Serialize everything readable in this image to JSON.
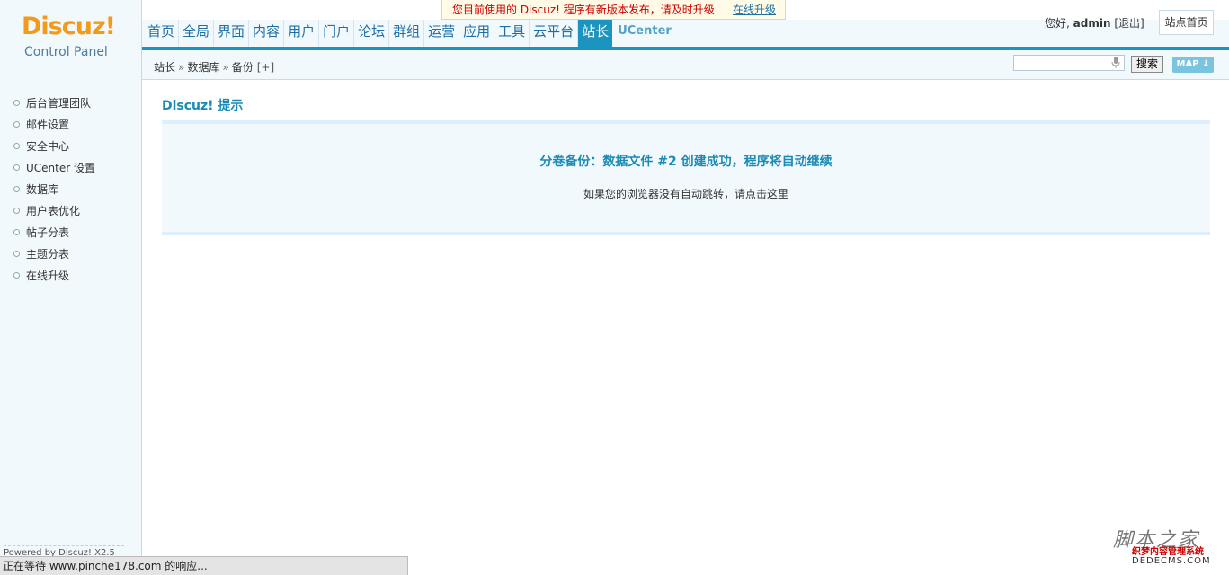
{
  "header": {
    "logo": "Discuz!",
    "logo_sub": "Control Panel",
    "notice_text": "您目前使用的 Discuz! 程序有新版本发布，请及时升级",
    "notice_link": "在线升级",
    "greeting_prefix": "您好, ",
    "username": "admin",
    "logout": "[退出]",
    "site_home": "站点首页",
    "search_button": "搜索",
    "map_button": "MAP"
  },
  "nav": {
    "items": [
      {
        "label": "首页"
      },
      {
        "label": "全局"
      },
      {
        "label": "界面"
      },
      {
        "label": "内容"
      },
      {
        "label": "用户"
      },
      {
        "label": "门户"
      },
      {
        "label": "论坛"
      },
      {
        "label": "群组"
      },
      {
        "label": "运营"
      },
      {
        "label": "应用"
      },
      {
        "label": "工具"
      },
      {
        "label": "云平台"
      },
      {
        "label": "站长"
      },
      {
        "label": "UCenter"
      }
    ],
    "active": "站长"
  },
  "breadcrumb": {
    "items": [
      "站长",
      "数据库",
      "备份"
    ],
    "separator": "»",
    "add": "[+]"
  },
  "sidebar": {
    "items": [
      {
        "label": "后台管理团队"
      },
      {
        "label": "邮件设置"
      },
      {
        "label": "安全中心"
      },
      {
        "label": "UCenter 设置"
      },
      {
        "label": "数据库"
      },
      {
        "label": "用户表优化"
      },
      {
        "label": "帖子分表"
      },
      {
        "label": "主题分表"
      },
      {
        "label": "在线升级"
      }
    ],
    "powered_by": "Powered by Discuz! X2.5"
  },
  "main": {
    "title": "Discuz! 提示",
    "message": "分卷备份：数据文件 #2 创建成功，程序将自动继续",
    "redirect_link": "如果您的浏览器没有自动跳转，请点击这里"
  },
  "statusbar": {
    "text": "正在等待 www.pinche178.com 的响应..."
  },
  "watermark": {
    "script": "脚本之家",
    "cn": "织梦内容管理系统",
    "en": "DEDECMS.COM"
  },
  "colors": {
    "accent": "#1b94bf",
    "logo": "#f39a1a",
    "panel_bg": "#f2f9fd"
  }
}
